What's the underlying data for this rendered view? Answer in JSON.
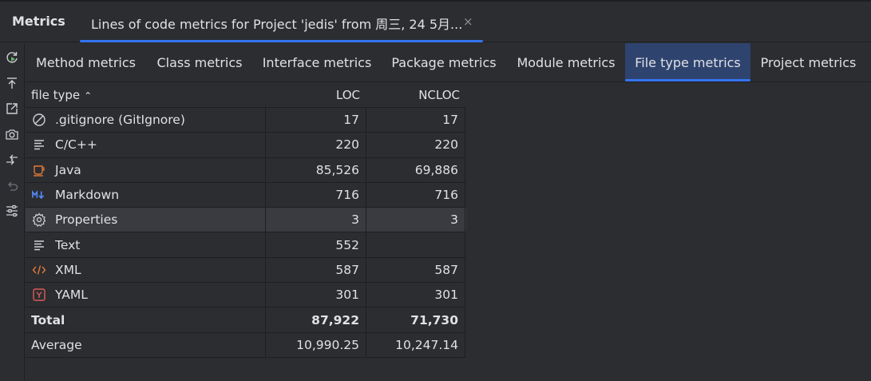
{
  "header": {
    "panel_title": "Metrics",
    "tab_label": "Lines of code metrics for Project 'jedis' from 周三, 24 5月...",
    "close_glyph": "×"
  },
  "toolbar": {
    "icons": [
      "refresh-icon",
      "export-icon",
      "open-external-icon",
      "snapshot-camera-icon",
      "compare-arrows-icon",
      "undo-icon",
      "settings-sliders-icon"
    ]
  },
  "subtabs": [
    {
      "label": "Method metrics",
      "active": false
    },
    {
      "label": "Class metrics",
      "active": false
    },
    {
      "label": "Interface metrics",
      "active": false
    },
    {
      "label": "Package metrics",
      "active": false
    },
    {
      "label": "Module metrics",
      "active": false
    },
    {
      "label": "File type metrics",
      "active": true
    },
    {
      "label": "Project metrics",
      "active": false
    }
  ],
  "table": {
    "columns": {
      "type": "file type",
      "loc": "LOC",
      "ncloc": "NCLOC"
    },
    "sort_glyph": "^",
    "rows": [
      {
        "icon": "gitignore-icon",
        "name": ".gitignore (GitIgnore)",
        "loc": "17",
        "ncloc": "17",
        "selected": false
      },
      {
        "icon": "text-lines-icon",
        "name": "C/C++",
        "loc": "220",
        "ncloc": "220",
        "selected": false
      },
      {
        "icon": "java-cup-icon",
        "name": "Java",
        "loc": "85,526",
        "ncloc": "69,886",
        "selected": false
      },
      {
        "icon": "markdown-icon",
        "name": "Markdown",
        "loc": "716",
        "ncloc": "716",
        "selected": false
      },
      {
        "icon": "gear-icon",
        "name": "Properties",
        "loc": "3",
        "ncloc": "3",
        "selected": true
      },
      {
        "icon": "text-lines-icon",
        "name": "Text",
        "loc": "552",
        "ncloc": "",
        "selected": false
      },
      {
        "icon": "xml-icon",
        "name": "XML",
        "loc": "587",
        "ncloc": "587",
        "selected": false
      },
      {
        "icon": "yaml-icon",
        "name": "YAML",
        "loc": "301",
        "ncloc": "301",
        "selected": false
      }
    ],
    "total": {
      "name": "Total",
      "loc": "87,922",
      "ncloc": "71,730"
    },
    "average": {
      "name": "Average",
      "loc": "10,990.25",
      "ncloc": "10,247.14"
    }
  },
  "colors": {
    "background": "#2b2d30",
    "accent": "#3574f0",
    "active_tab_bg": "#2e436e",
    "selected_row": "#393b40",
    "java_orange": "#e07a3a",
    "markdown_blue": "#548af7",
    "yaml_red": "#db5c5c"
  }
}
